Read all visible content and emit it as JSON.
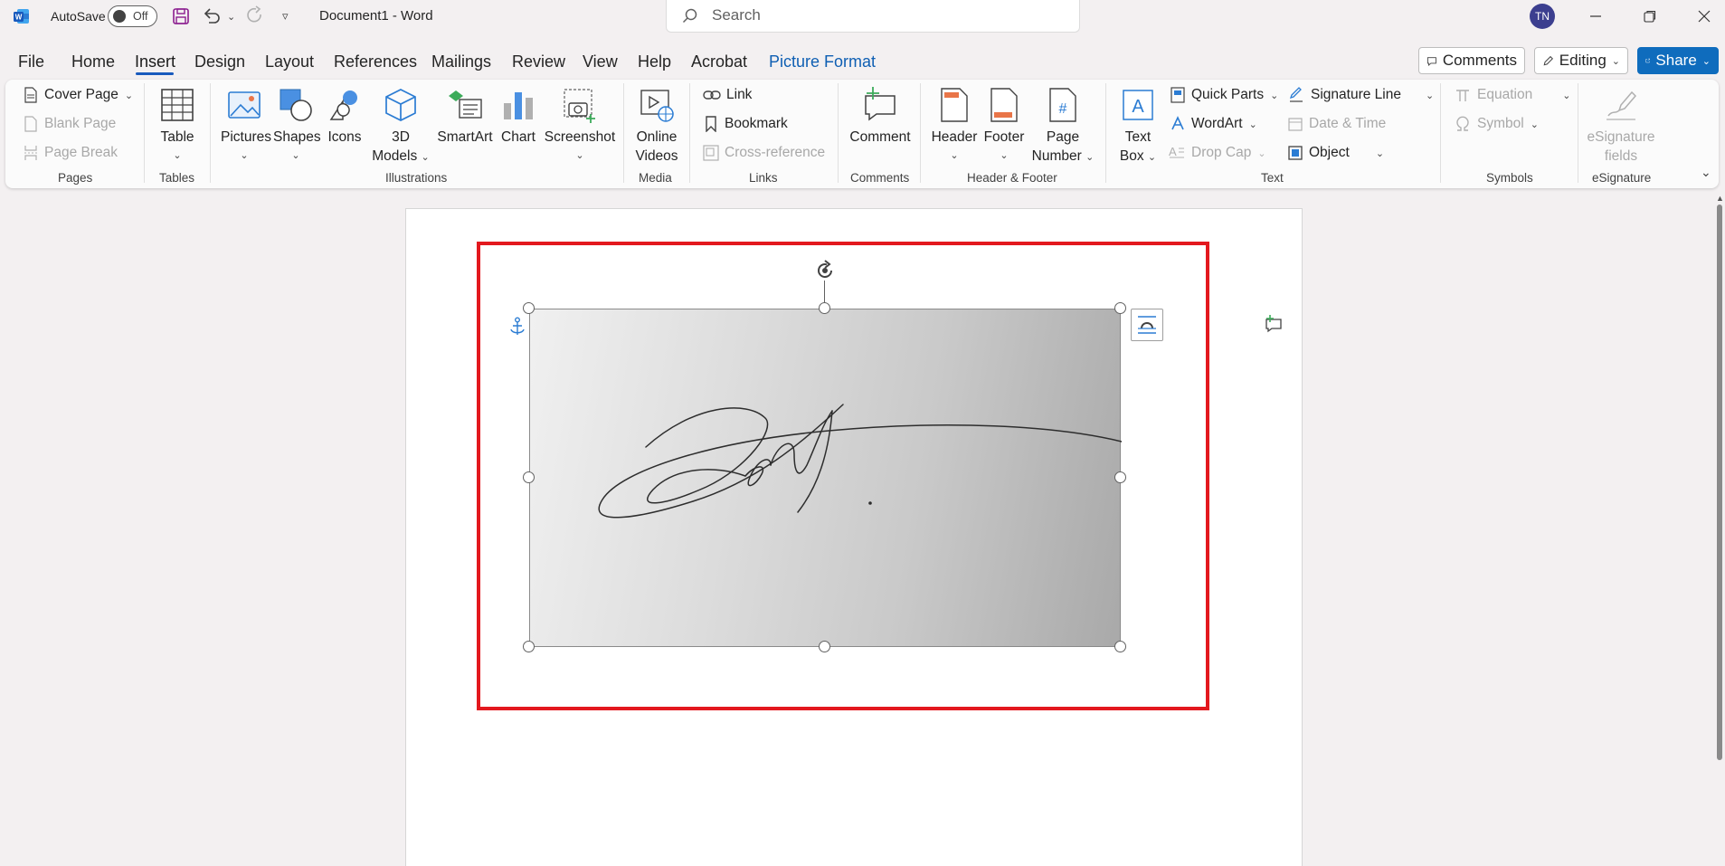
{
  "titlebar": {
    "autosave_label": "AutoSave",
    "autosave_state": "Off",
    "doc_title": "Document1 - Word",
    "search_placeholder": "Search",
    "user_initials": "TN"
  },
  "tabs": [
    "File",
    "Home",
    "Insert",
    "Design",
    "Layout",
    "References",
    "Mailings",
    "Review",
    "View",
    "Help",
    "Acrobat",
    "Picture Format"
  ],
  "active_tab": "Insert",
  "header_buttons": {
    "comments": "Comments",
    "editing": "Editing",
    "share": "Share"
  },
  "ribbon": {
    "pages": {
      "cover_page": "Cover Page",
      "blank_page": "Blank Page",
      "page_break": "Page Break",
      "group": "Pages"
    },
    "tables": {
      "table": "Table",
      "group": "Tables"
    },
    "illustrations": {
      "pictures": "Pictures",
      "shapes": "Shapes",
      "icons": "Icons",
      "models_1": "3D",
      "models_2": "Models",
      "smartart": "SmartArt",
      "chart": "Chart",
      "screenshot": "Screenshot",
      "group": "Illustrations"
    },
    "media": {
      "online_1": "Online",
      "online_2": "Videos",
      "group": "Media"
    },
    "links": {
      "link": "Link",
      "bookmark": "Bookmark",
      "cross_ref": "Cross-reference",
      "group": "Links"
    },
    "comments": {
      "comment": "Comment",
      "group": "Comments"
    },
    "header_footer": {
      "header": "Header",
      "footer": "Footer",
      "page_number_1": "Page",
      "page_number_2": "Number",
      "group": "Header & Footer"
    },
    "text": {
      "textbox_1": "Text",
      "textbox_2": "Box",
      "quick_parts": "Quick Parts",
      "wordart": "WordArt",
      "drop_cap": "Drop Cap",
      "signature_line": "Signature Line",
      "date_time": "Date & Time",
      "object": "Object",
      "group": "Text"
    },
    "symbols": {
      "equation": "Equation",
      "symbol": "Symbol",
      "group": "Symbols"
    },
    "esignature": {
      "fields_1": "eSignature",
      "fields_2": "fields",
      "group": "eSignature"
    }
  },
  "colors": {
    "accent": "#185abd",
    "share_bg": "#0f6cbd",
    "selection_frame": "#e3181e",
    "picture_format": "#0f5fb3"
  }
}
